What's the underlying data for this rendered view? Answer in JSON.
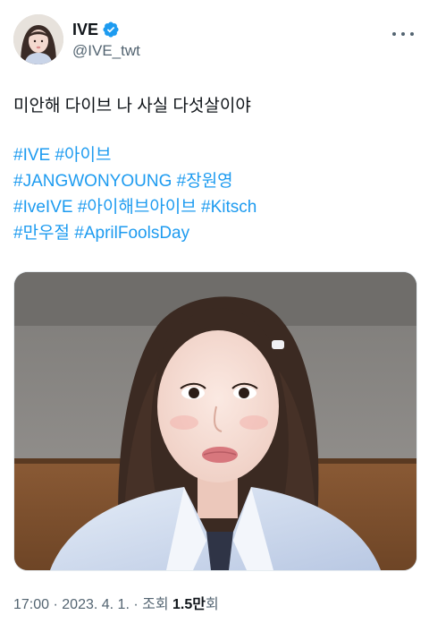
{
  "account": {
    "display_name": "IVE",
    "handle": "@IVE_twt",
    "verified_icon": "verified-badge-icon",
    "accent_color": "#1d9bf0"
  },
  "tweet": {
    "text_line1": "미안해 다이브 나 사실 다섯살이야",
    "hashtags": {
      "ive": "#IVE",
      "aive": "#아이브",
      "jangwonyoung": "#JANGWONYOUNG",
      "jangwonyoung_kr": "#장원영",
      "iveive": "#IveIVE",
      "aihaebeu": "#아이해브아이브",
      "kitsch": "#Kitsch",
      "manujeol": "#만우절",
      "aprilfools": "#AprilFoolsDay"
    }
  },
  "media": {
    "description_icon": "photo"
  },
  "meta": {
    "time": "17:00",
    "sep1": " · ",
    "date": "2023. 4. 1.",
    "sep2": " · ",
    "views_label": "조회 ",
    "views_value": "1.5만",
    "views_unit": "회"
  }
}
